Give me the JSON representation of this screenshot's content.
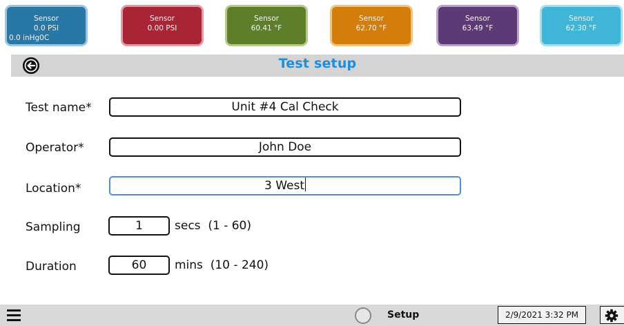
{
  "sensors": [
    {
      "line1": "Sensor",
      "line2": "0.0 PSI",
      "line3": "0.0 inHg0C",
      "bg": "#2977a4",
      "border": "#9ac6e6"
    },
    {
      "line1": "Sensor",
      "line2": "0.00 PSI",
      "line3": "",
      "bg": "#a82536",
      "border": "#e39aa4"
    },
    {
      "line1": "Sensor",
      "line2": "60.41 °F",
      "line3": "",
      "bg": "#5e7e2b",
      "border": "#b3cc8a"
    },
    {
      "line1": "Sensor",
      "line2": "62.70 °F",
      "line3": "",
      "bg": "#d27d0c",
      "border": "#f4c47a"
    },
    {
      "line1": "Sensor",
      "line2": "63.49 °F",
      "line3": "",
      "bg": "#5d3a76",
      "border": "#b9a2cc"
    },
    {
      "line1": "Sensor",
      "line2": "62.30 °F",
      "line3": "",
      "bg": "#3fb6d8",
      "border": "#a5e0f0"
    }
  ],
  "header": {
    "title": "Test setup",
    "back_icon": "back-arrow-icon",
    "title_color": "#1a8fe0"
  },
  "form": {
    "test_name": {
      "label": "Test name*",
      "value": "Unit #4 Cal Check"
    },
    "operator": {
      "label": "Operator*",
      "value": "John Doe"
    },
    "location": {
      "label": "Location*",
      "value": "3 West"
    },
    "sampling": {
      "label": "Sampling",
      "value": "1",
      "unit": "secs",
      "range": "(1 - 60)"
    },
    "duration": {
      "label": "Duration",
      "value": "60",
      "unit": "mins",
      "range": "(10 - 240)"
    }
  },
  "footer": {
    "menu_icon": "hamburger-menu-icon",
    "status": "Setup",
    "datetime": "2/9/2021 3:32 PM",
    "settings_icon": "gear-icon"
  }
}
